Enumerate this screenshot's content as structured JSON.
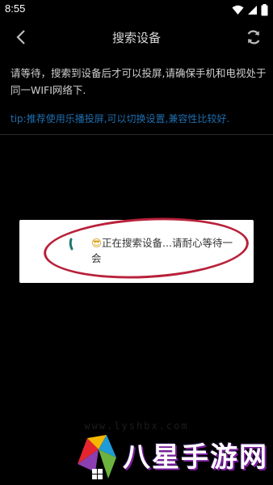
{
  "status_bar": {
    "time": "8:55"
  },
  "header": {
    "title": "搜索设备"
  },
  "content": {
    "hint": "请等待，搜索到设备后才可以投屏,请确保手机和电视处于同一WIFI网络下.",
    "tip": "tip:推荐使用乐播投屏,可以切换设置,兼容性比较好."
  },
  "dialog": {
    "emoji": "😎",
    "message": "正在搜索设备...请耐心等待一会"
  },
  "watermark": {
    "url": "www.lyshbx.com",
    "brand": "八星手游网"
  },
  "colors": {
    "background": "#000000",
    "tip": "#1f6fb0",
    "annotation": "#b8213a",
    "spinner": "#1f7a6e"
  }
}
